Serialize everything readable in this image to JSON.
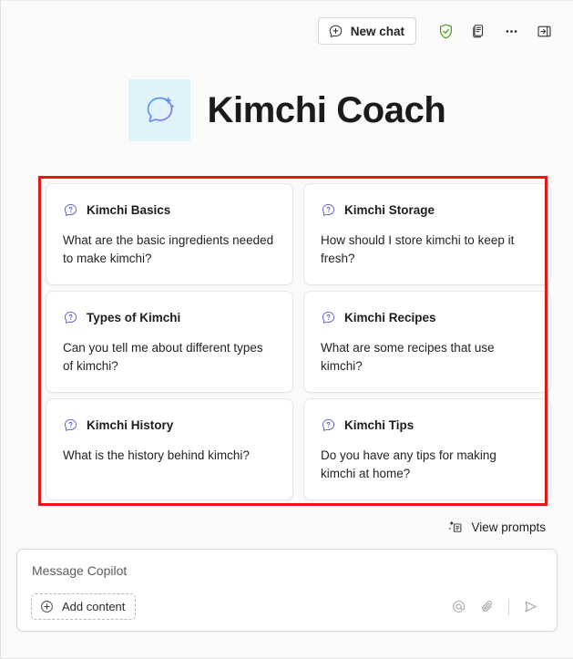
{
  "app": {
    "title": "Kimchi Coach",
    "logo_icon": "chat-sparkle-icon",
    "logo_bg": "#e0f3fb"
  },
  "topbar": {
    "new_chat_label": "New chat",
    "new_chat_icon": "chat-plus-icon",
    "actions": [
      {
        "name": "shield-check-icon",
        "label": "Protected",
        "color": "#4f9c1f"
      },
      {
        "name": "pages-icon",
        "label": "Pages",
        "color": "#333333"
      },
      {
        "name": "more-options-icon",
        "label": "More options",
        "color": "#333333"
      },
      {
        "name": "expand-panel-icon",
        "label": "Expand panel",
        "color": "#333333"
      }
    ]
  },
  "prompts": {
    "highlight_color": "#e8151a",
    "card_icon": "chat-question-icon",
    "cards": [
      {
        "title": "Kimchi Basics",
        "body": "What are the basic ingredients needed to make kimchi?"
      },
      {
        "title": "Kimchi Storage",
        "body": "How should I store kimchi to keep it fresh?"
      },
      {
        "title": "Types of Kimchi",
        "body": "Can you tell me about different types of kimchi?"
      },
      {
        "title": "Kimchi Recipes",
        "body": "What are some recipes that use kimchi?"
      },
      {
        "title": "Kimchi History",
        "body": "What is the history behind kimchi?"
      },
      {
        "title": "Kimchi Tips",
        "body": "Do you have any tips for making kimchi at home?"
      }
    ]
  },
  "view_prompts": {
    "label": "View prompts",
    "icon": "prompt-sparkle-icon"
  },
  "composer": {
    "placeholder": "Message Copilot",
    "value": "",
    "add_content_label": "Add content",
    "add_content_icon": "plus-circle-icon",
    "actions": [
      {
        "name": "mention-icon",
        "label": "Mention"
      },
      {
        "name": "attach-icon",
        "label": "Attach file"
      },
      {
        "name": "send-icon",
        "label": "Send"
      }
    ]
  }
}
